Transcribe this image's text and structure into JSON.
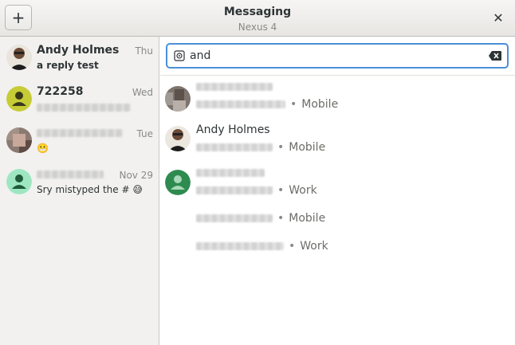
{
  "header": {
    "title": "Messaging",
    "subtitle": "Nexus 4",
    "add_icon": "plus-icon",
    "close_icon": "close-icon"
  },
  "conversations": [
    {
      "name": "Andy Holmes",
      "time": "Thu",
      "snippet": "a reply test",
      "unread": true
    },
    {
      "name": "722258",
      "time": "Wed",
      "snippet": "",
      "unread": true
    },
    {
      "name": "",
      "time": "Tue",
      "snippet": "😬",
      "unread": false
    },
    {
      "name": "",
      "time": "Nov 29",
      "snippet": "Sry mistyped the # 😅",
      "unread": false
    }
  ],
  "search": {
    "value": "and",
    "icon": "message-search-icon",
    "clear_icon": "clear-text-icon"
  },
  "contacts": [
    {
      "name": "",
      "numbers": [
        {
          "type": "Mobile"
        }
      ]
    },
    {
      "name": "Andy Holmes",
      "numbers": [
        {
          "type": "Mobile"
        }
      ]
    },
    {
      "name": "",
      "numbers": [
        {
          "type": "Work"
        },
        {
          "type": "Mobile"
        },
        {
          "type": "Work"
        }
      ]
    }
  ],
  "colors": {
    "accent": "#4a90d9",
    "avatar_yellow": "#c6cc35",
    "avatar_mint": "#9ee6c1",
    "avatar_green": "#2e8b4f"
  }
}
